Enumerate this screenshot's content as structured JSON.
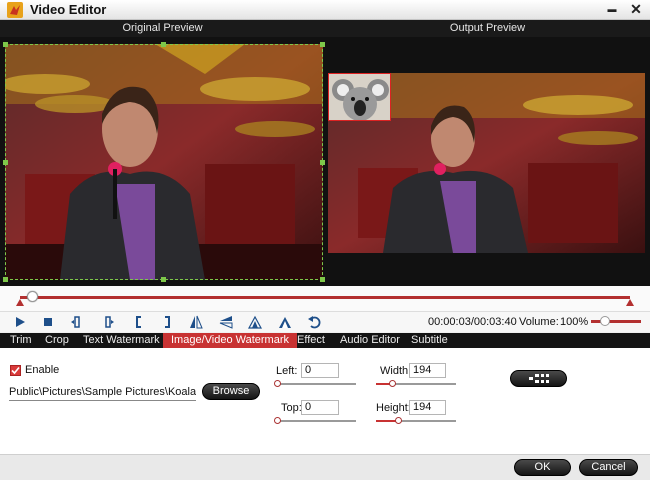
{
  "window": {
    "title": "Video Editor",
    "minimize": "▬",
    "close": "✕"
  },
  "preview": {
    "original_label": "Original Preview",
    "output_label": "Output Preview"
  },
  "playback": {
    "timecode": "00:00:03/00:03:40",
    "volume_label": "Volume:",
    "volume_value": "100%"
  },
  "controls": [
    "play-icon",
    "stop-icon",
    "prev-frame-icon",
    "next-frame-icon",
    "mark-in-icon",
    "mark-out-icon",
    "flip-vertical-icon",
    "flip-horizontal-icon",
    "rotate-left-icon",
    "rotate-right-icon",
    "undo-icon"
  ],
  "tabs": [
    {
      "label": "Trim"
    },
    {
      "label": "Crop"
    },
    {
      "label": "Text Watermark"
    },
    {
      "label": "Image/Video Watermark",
      "active": true
    },
    {
      "label": "Effect"
    },
    {
      "label": "Audio Editor"
    },
    {
      "label": "Subtitle"
    }
  ],
  "watermark": {
    "enable_label": "Enable",
    "enabled": true,
    "path": "Public\\Pictures\\Sample Pictures\\Koala.jpg",
    "browse_label": "Browse",
    "left_label": "Left:",
    "left_value": "0",
    "top_label": "Top:",
    "top_value": "0",
    "width_label": "Width:",
    "width_value": "194",
    "height_label": "Height:",
    "height_value": "194"
  },
  "footer": {
    "ok_label": "OK",
    "cancel_label": "Cancel"
  },
  "colors": {
    "accent": "#c83232",
    "dark": "#141414",
    "crop_guide": "#7ec84a"
  }
}
